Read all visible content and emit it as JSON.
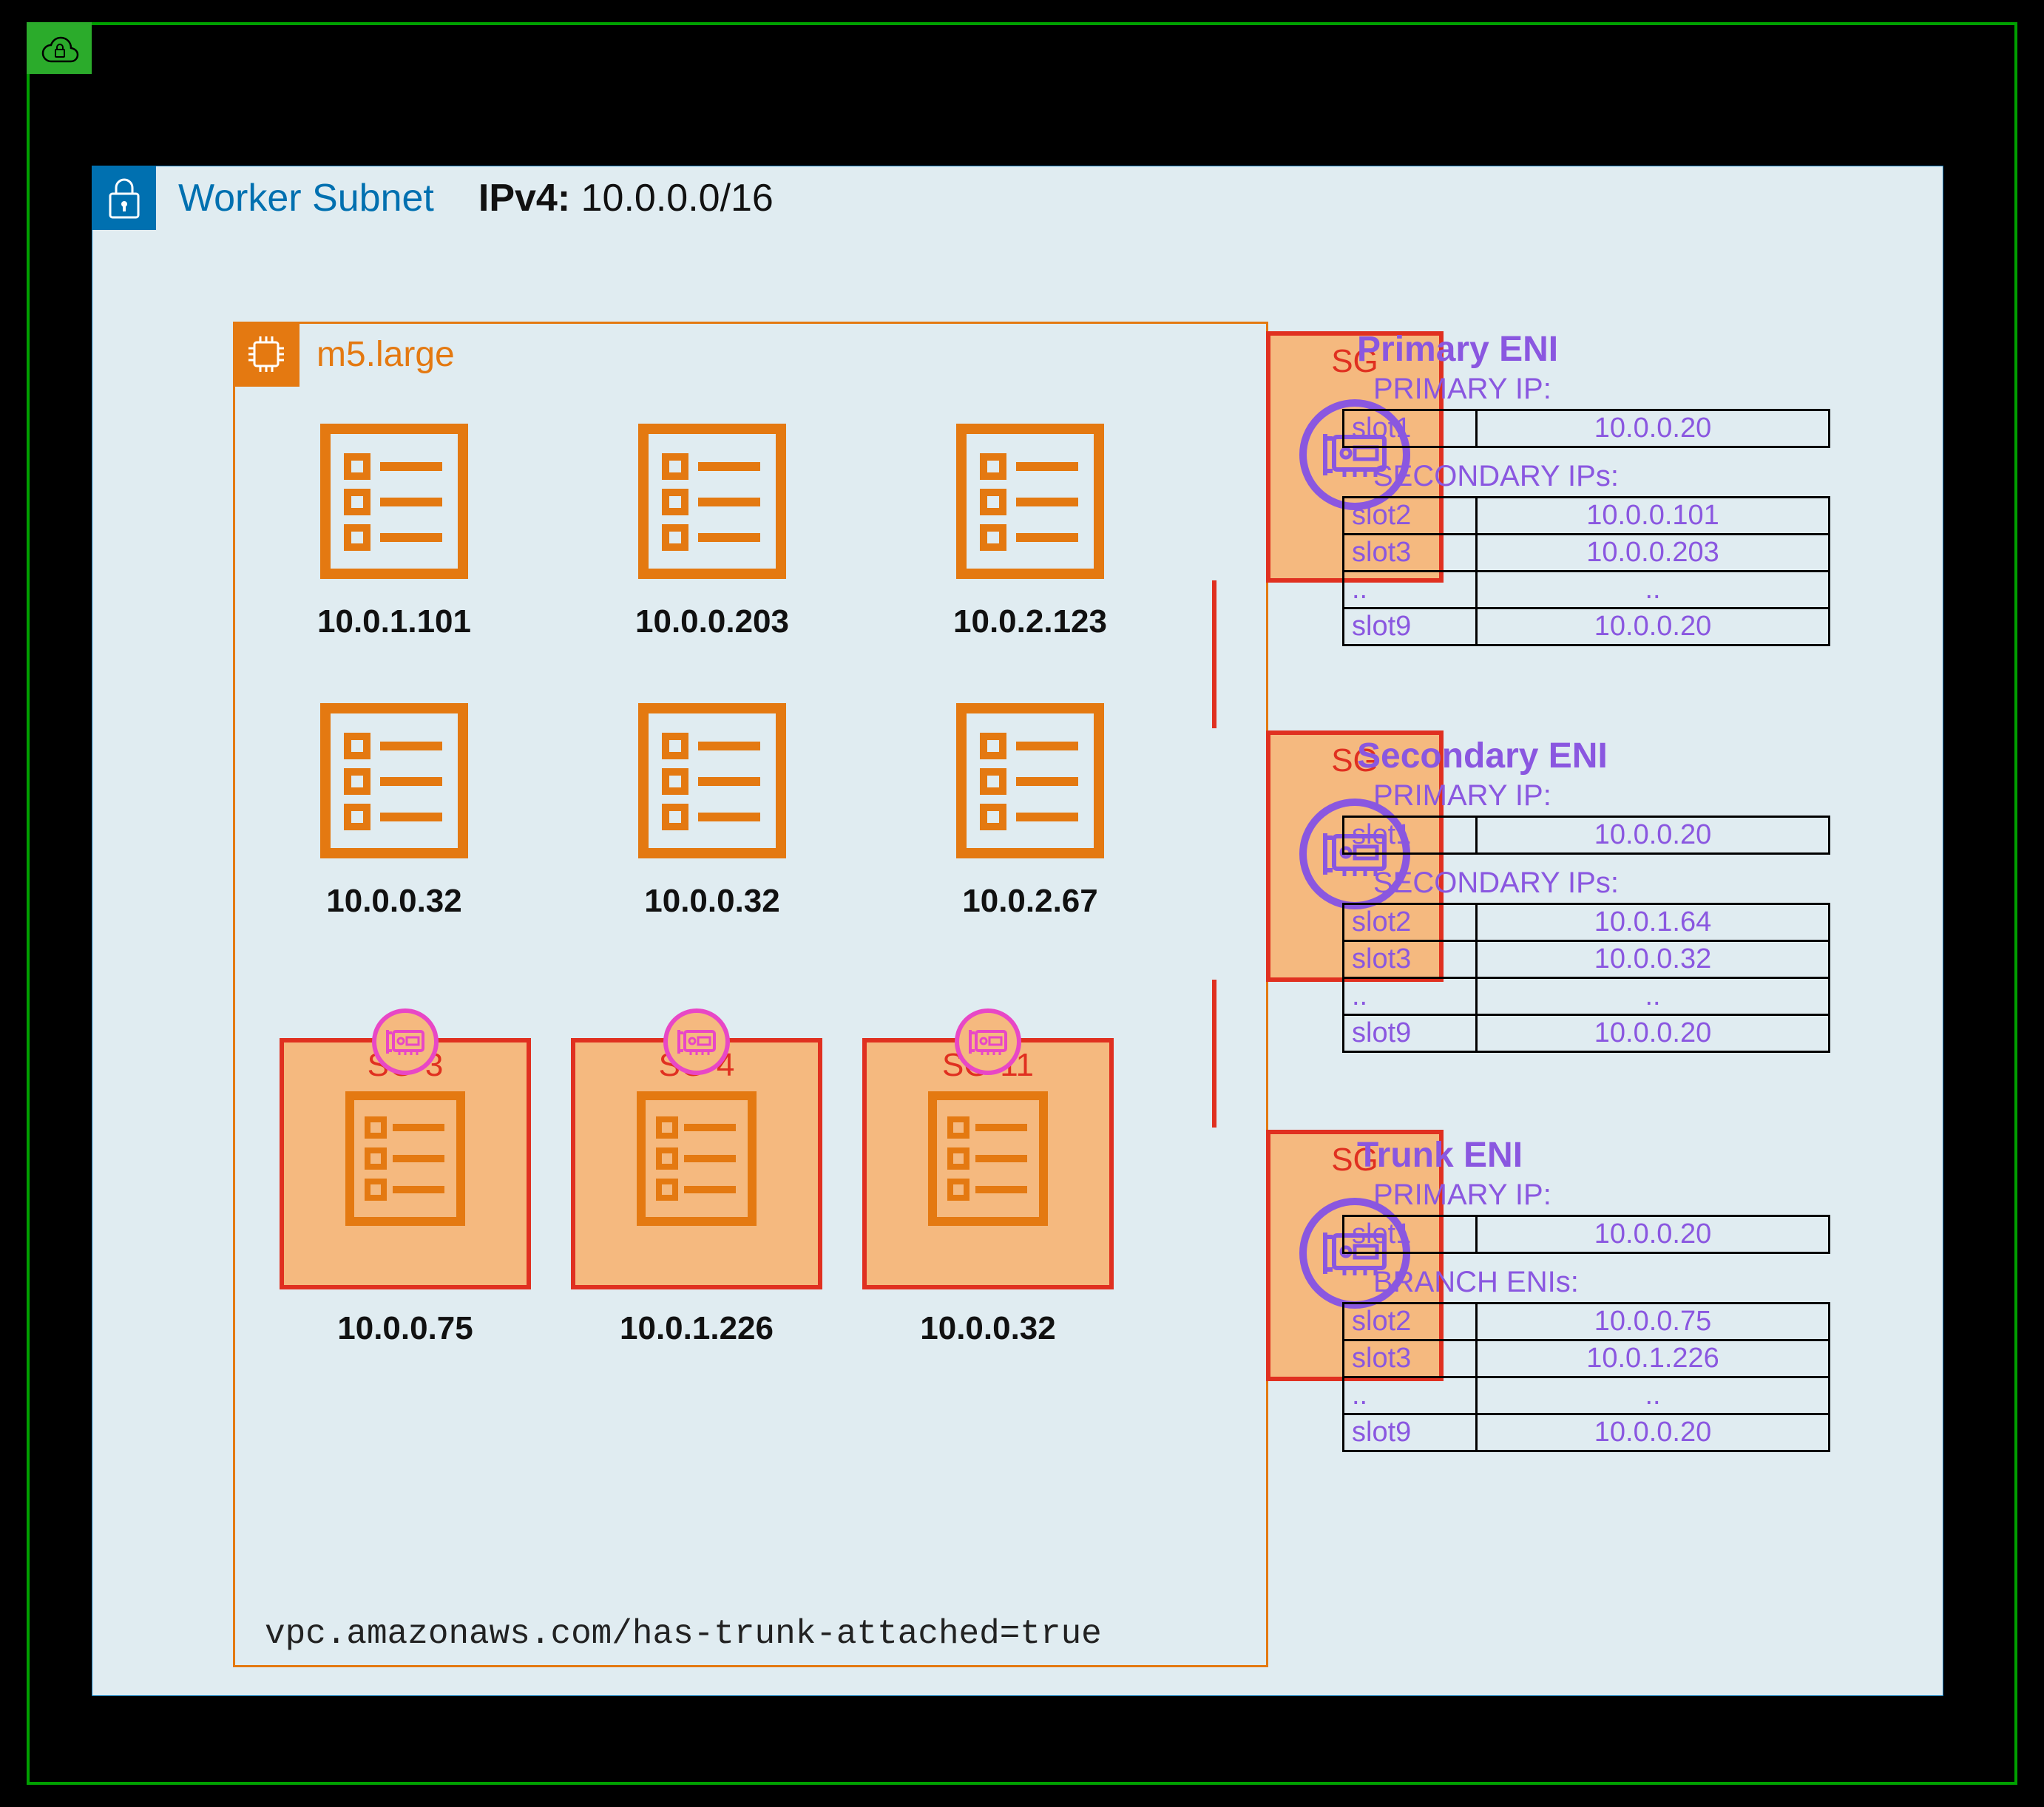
{
  "subnet": {
    "title": "Worker Subnet",
    "ipv4_label": "IPv4:",
    "ipv4_value": "10.0.0.0/16"
  },
  "instance": {
    "type": "m5.large",
    "annotation": "vpc.amazonaws.com/has-trunk-attached=true"
  },
  "pods": {
    "row1": [
      {
        "ip": "10.0.1.101"
      },
      {
        "ip": "10.0.0.203"
      },
      {
        "ip": "10.0.2.123"
      }
    ],
    "row2": [
      {
        "ip": "10.0.0.32"
      },
      {
        "ip": "10.0.0.32"
      },
      {
        "ip": "10.0.2.67"
      }
    ],
    "row3": [
      {
        "sg": "SG-3",
        "ip": "10.0.0.75"
      },
      {
        "sg": "SG-4",
        "ip": "10.0.1.226"
      },
      {
        "sg": "SG-11",
        "ip": "10.0.0.32"
      }
    ]
  },
  "eni_sg_label": "SG",
  "enis": {
    "primary": {
      "title": "Primary ENI",
      "primary_label": "PRIMARY IP:",
      "secondary_label": "SECONDARY IPs:",
      "primary_ip": {
        "slot": "slot1",
        "ip": "10.0.0.20"
      },
      "secondary": [
        {
          "slot": "slot2",
          "ip": "10.0.0.101"
        },
        {
          "slot": "slot3",
          "ip": "10.0.0.203"
        },
        {
          "slot": "..",
          "ip": ".."
        },
        {
          "slot": "slot9",
          "ip": "10.0.0.20"
        }
      ]
    },
    "secondary": {
      "title": "Secondary ENI",
      "primary_label": "PRIMARY IP:",
      "secondary_label": "SECONDARY IPs:",
      "primary_ip": {
        "slot": "slot1",
        "ip": "10.0.0.20"
      },
      "secondary": [
        {
          "slot": "slot2",
          "ip": "10.0.1.64"
        },
        {
          "slot": "slot3",
          "ip": "10.0.0.32"
        },
        {
          "slot": "..",
          "ip": ".."
        },
        {
          "slot": "slot9",
          "ip": "10.0.0.20"
        }
      ]
    },
    "trunk": {
      "title": "Trunk ENI",
      "primary_label": "PRIMARY IP:",
      "branch_label": "BRANCH ENIs:",
      "primary_ip": {
        "slot": "slot1",
        "ip": "10.0.0.20"
      },
      "branch": [
        {
          "slot": "slot2",
          "ip": "10.0.0.75"
        },
        {
          "slot": "slot3",
          "ip": "10.0.1.226"
        },
        {
          "slot": "..",
          "ip": ".."
        },
        {
          "slot": "slot9",
          "ip": "10.0.0.20"
        }
      ]
    }
  }
}
